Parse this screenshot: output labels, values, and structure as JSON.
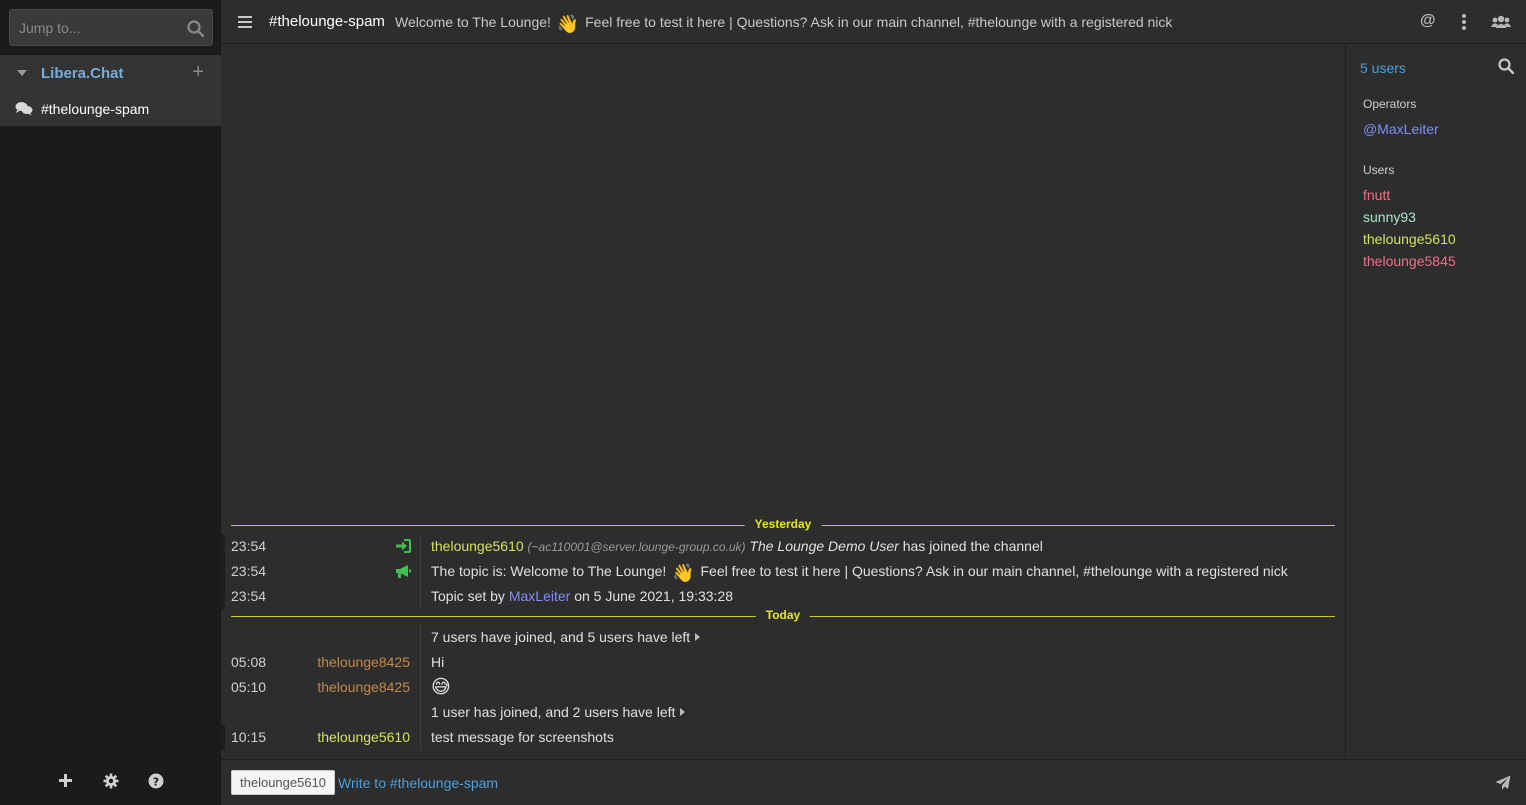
{
  "sidebar": {
    "jump_placeholder": "Jump to...",
    "network_name": "Libera.Chat",
    "channel_name": "#thelounge-spam"
  },
  "header": {
    "channel": "#thelounge-spam",
    "topic_before": "Welcome to The Lounge!",
    "topic_emoji": "👋",
    "topic_after": "Feel free to test it here | Questions? Ask in our main channel, #thelounge with a registered nick",
    "mentions_label": "@"
  },
  "chat": {
    "divider_yesterday": "Yesterday",
    "divider_today": "Today",
    "join": {
      "time": "23:54",
      "nick": "thelounge5610",
      "hostmask": "(~ac110001@server.lounge-group.co.uk)",
      "realname": "The Lounge Demo User",
      "text": "has joined the channel"
    },
    "topic": {
      "time": "23:54",
      "prefix": "The topic is: Welcome to The Lounge!",
      "emoji": "👋",
      "suffix": "Feel free to test it here | Questions? Ask in our main channel, #thelounge with a registered nick"
    },
    "topic_set": {
      "time": "23:54",
      "prefix": "Topic set by",
      "nick": "MaxLeiter",
      "suffix": "on 5 June 2021, 19:33:28"
    },
    "condensed_1": "7 users have joined, and 5 users have left",
    "msg_hi": {
      "time": "05:08",
      "nick": "thelounge8425",
      "text": "Hi"
    },
    "msg_emoji": {
      "time": "05:10",
      "nick": "thelounge8425",
      "text": "😅"
    },
    "condensed_2": "1 user has joined, and 2 users have left",
    "msg_test": {
      "time": "10:15",
      "nick": "thelounge5610",
      "text": "test message for screenshots"
    }
  },
  "userlist": {
    "count": "5 users",
    "operators_label": "Operators",
    "operators": [
      "@MaxLeiter"
    ],
    "users_label": "Users",
    "users": [
      "fnutt",
      "sunny93",
      "thelounge5610",
      "thelounge5845"
    ]
  },
  "input": {
    "nick": "thelounge5610",
    "placeholder": "Write to #thelounge-spam"
  },
  "colors": {
    "accent": "#4a9fe0",
    "divider": "#e6e628",
    "operator": "#7e8ef5",
    "fnutt": "#f0707a",
    "sunny93": "#a8e6c8",
    "thelounge5610": "#d6e35a",
    "thelounge5845": "#ef6f86",
    "thelounge8425": "#c28a4a",
    "join_icon": "#3fbf4f"
  }
}
